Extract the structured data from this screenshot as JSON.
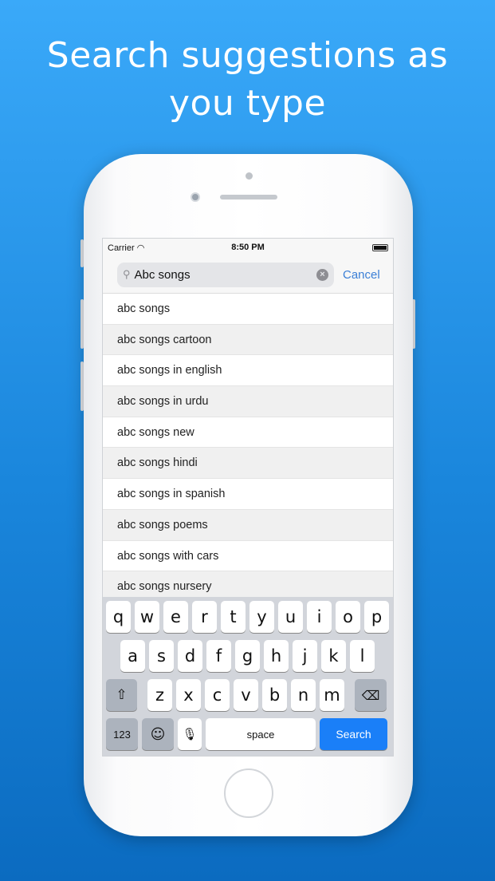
{
  "headline": {
    "line1": "Search suggestions as",
    "line2": "you type"
  },
  "status": {
    "carrier": "Carrier",
    "time": "8:50 PM"
  },
  "search": {
    "value": "Abc songs",
    "cancel": "Cancel"
  },
  "suggestions": [
    "abc songs",
    "abc songs cartoon",
    "abc songs in english",
    "abc songs in urdu",
    "abc songs new",
    "abc songs hindi",
    "abc songs in spanish",
    "abc songs poems",
    "abc songs with cars",
    "abc songs nursery"
  ],
  "keyboard": {
    "row1": [
      "q",
      "w",
      "e",
      "r",
      "t",
      "y",
      "u",
      "i",
      "o",
      "p"
    ],
    "row2": [
      "a",
      "s",
      "d",
      "f",
      "g",
      "h",
      "j",
      "k",
      "l"
    ],
    "row3": [
      "z",
      "x",
      "c",
      "v",
      "b",
      "n",
      "m"
    ],
    "numbers": "123",
    "space": "space",
    "search": "Search"
  },
  "colors": {
    "accent": "#1a7ff8",
    "cancel": "#3b7fd6"
  }
}
